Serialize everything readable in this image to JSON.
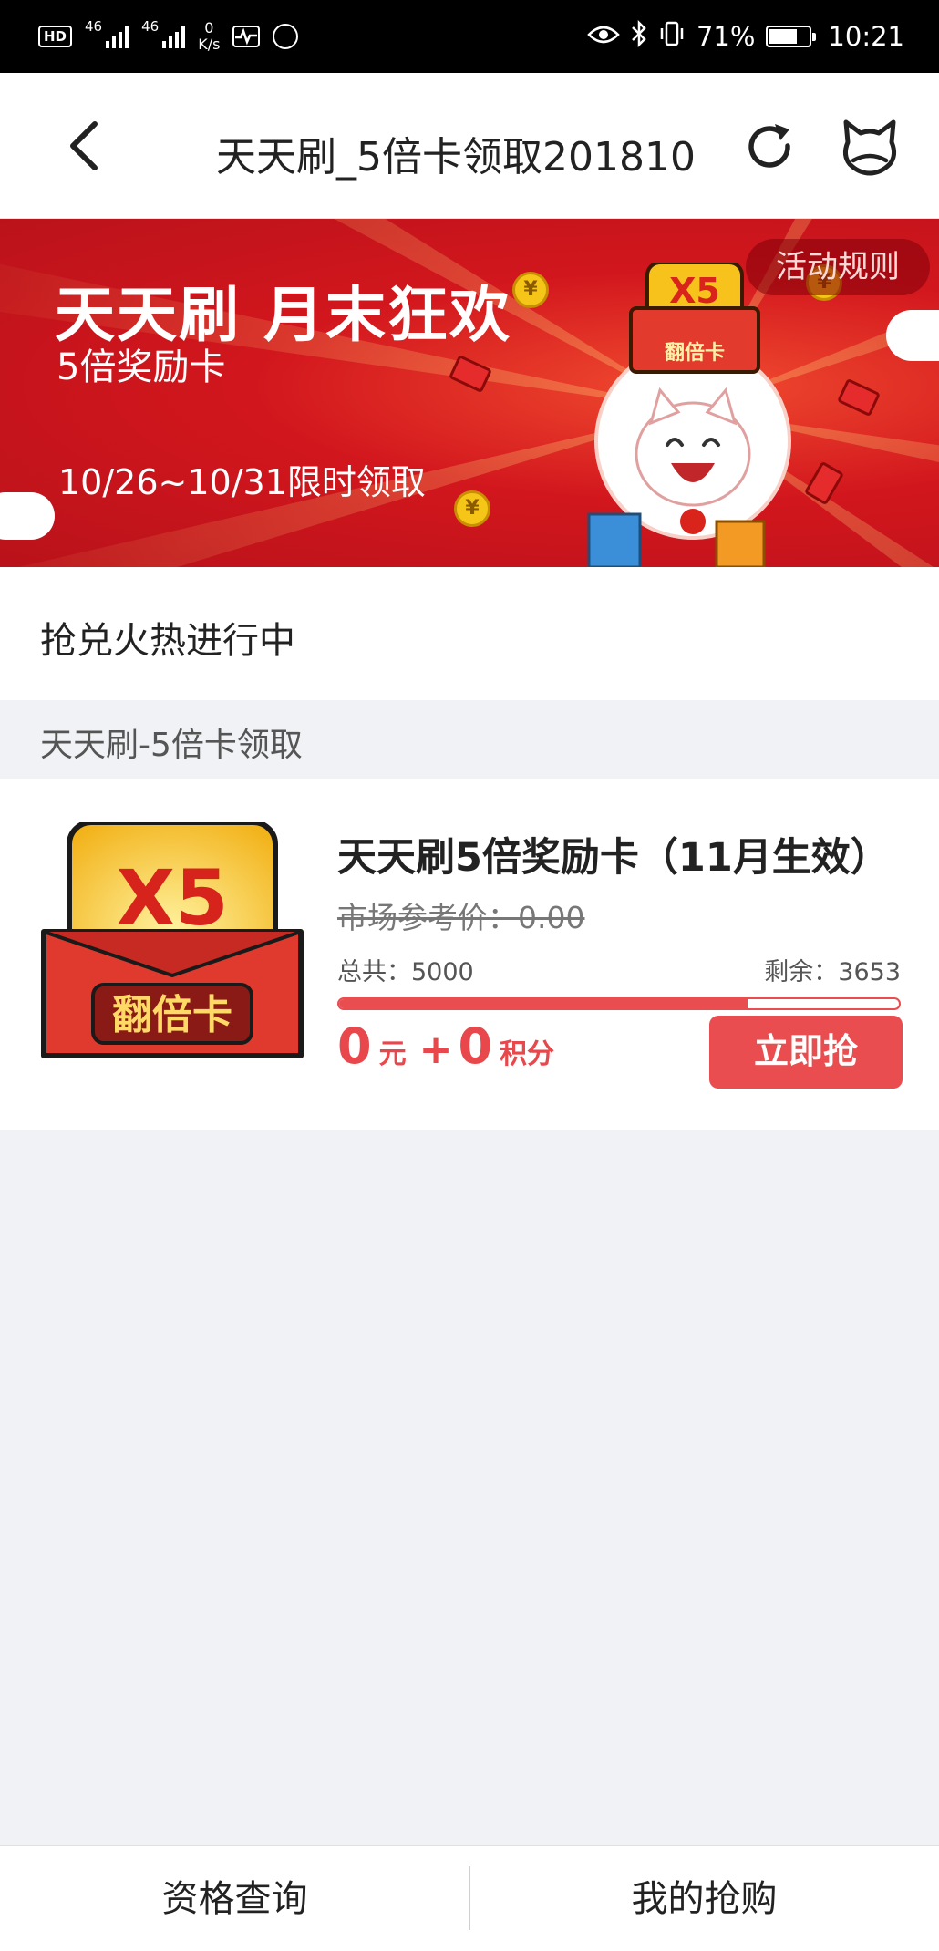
{
  "status_bar": {
    "hd": "HD",
    "signal1": "46",
    "signal2": "46",
    "net_speed_value": "0",
    "net_speed_unit": "K/s",
    "battery_percent": "71%",
    "battery_level": 0.71,
    "time": "10:21"
  },
  "navbar": {
    "title": "天天刷_5倍卡领取201810",
    "back_icon": "chevron-left-icon",
    "refresh_icon": "refresh-icon",
    "mascot_icon": "cat-mascot-icon"
  },
  "banner": {
    "title": "天天刷 月末狂欢",
    "subtitle": "5倍奖励卡",
    "date_range": "10/26~10/31限时领取",
    "rules_label": "活动规则",
    "card_badge": "X5",
    "card_caption": "翻倍卡",
    "coin_symbol": "¥"
  },
  "sections": {
    "status_label": "抢兑火热进行中",
    "category_label": "天天刷-5倍卡领取"
  },
  "product": {
    "title": "天天刷5倍奖励卡（11月生效）",
    "market_price": "市场参考价：0.00",
    "total": "总共：5000",
    "remaining": "剩余：3653",
    "progress_ratio": 0.73,
    "cost_yuan": "0",
    "yuan_unit": "元",
    "plus": "+",
    "cost_points": "0",
    "points_unit": "积分",
    "buy_label": "立即抢",
    "image_badge": "X5",
    "image_caption": "翻倍卡",
    "colors": {
      "accent": "#ea4d4f"
    }
  },
  "tabs": [
    {
      "label": "资格查询"
    },
    {
      "label": "我的抢购"
    }
  ]
}
